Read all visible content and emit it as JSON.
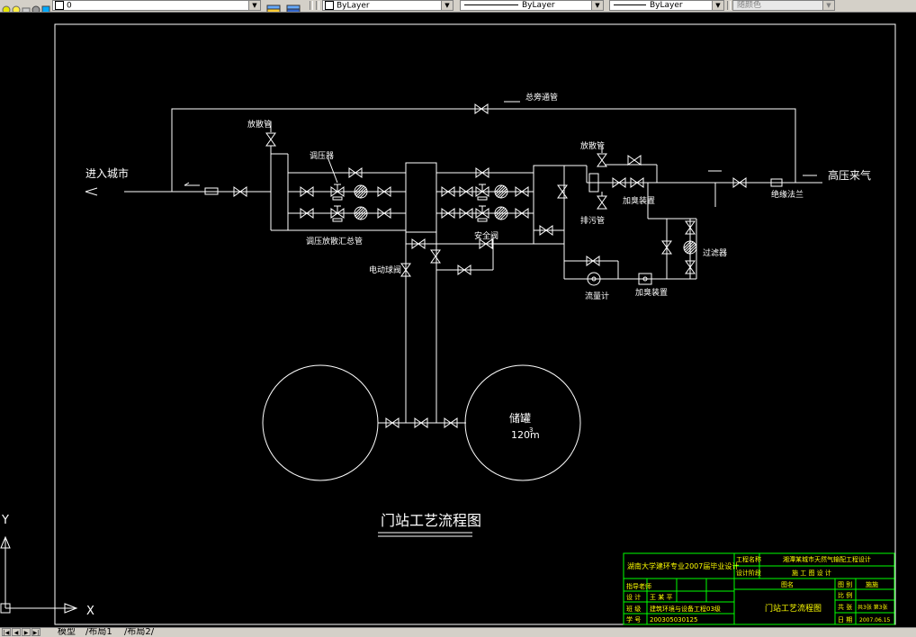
{
  "toolbar": {
    "layer_value": "0",
    "color_value": "ByLayer",
    "linetype_value": "ByLayer",
    "lineweight_value": "ByLayer",
    "plotstyle_value": "随颜色"
  },
  "drawing": {
    "labels": {
      "bypass": "总旁通管",
      "vent_left": "放散管",
      "regulator": "调压器",
      "to_city": "进入城市",
      "manifold": "调压放散汇总管",
      "relief": "安全阀",
      "esd_valve": "电动球阀",
      "vent_right": "放散管",
      "odorizer": "加臭装置",
      "drain": "排污管",
      "insulating_flange": "绝缘法兰",
      "high_pressure_in": "高压来气",
      "filter": "过滤器",
      "flow_meter": "流量计",
      "odor_device": "加臭装置",
      "tank": "储罐",
      "tank_volume": "120m",
      "tank_volume_sup": "3"
    },
    "title": "门站工艺流程图",
    "ucs_y": "Y",
    "ucs_x": "X"
  },
  "title_block": {
    "school": "湖南大学建环专业2007届毕业设计",
    "project_label": "工程名称",
    "project_value": "湘潭某城市天然气输配工程设计",
    "stage_label": "设计阶段",
    "stage_value": "施 工 图 设 计",
    "drawing_name_label": "图名",
    "drawing_no_label": "图 别",
    "drawing_no_value": "施施",
    "drawing_name_value": "门站工艺流程图",
    "r1a": "指导老师",
    "r2a": "设 计",
    "r2b": "王 某 平",
    "r3a": "班 级",
    "r3b": "建筑环境与设备工程03级",
    "r4a": "学 号",
    "r4b": "200305030125",
    "check_label": "比 例",
    "check_value": "",
    "sheet_label": "共 张",
    "sheet_value": "共3张 第3张",
    "date_label": "日 期",
    "date_value": "2007.06.15"
  },
  "tabs": {
    "model": "模型",
    "layout1": "布局1",
    "layout2": "布局2"
  },
  "colors": {
    "background": "#000000",
    "line": "#ffffff",
    "title_block": "#00ff00",
    "title_text": "#ffff00"
  }
}
